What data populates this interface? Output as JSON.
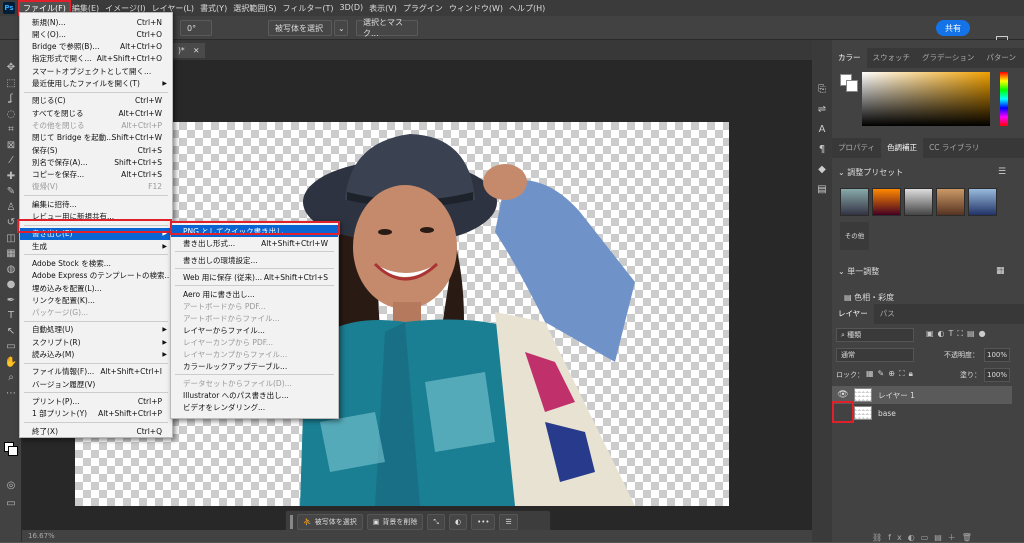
{
  "menubar": {
    "logo": "Ps",
    "items": [
      "ファイル(F)",
      "編集(E)",
      "イメージ(I)",
      "レイヤー(L)",
      "書式(Y)",
      "選択範囲(S)",
      "フィルター(T)",
      "3D(D)",
      "表示(V)",
      "プラグイン",
      "ウィンドウ(W)",
      "ヘルプ(H)"
    ]
  },
  "optbar": {
    "angle": "0°",
    "select_subject": "被写体を選択",
    "select_mask": "選択とマスク...",
    "share": "共有"
  },
  "doc_tab": {
    "title": ")*"
  },
  "file_menu": [
    {
      "label": "新規(N)...",
      "shortcut": "Ctrl+N"
    },
    {
      "label": "開く(O)...",
      "shortcut": "Ctrl+O"
    },
    {
      "label": "Bridge で参照(B)...",
      "shortcut": "Alt+Ctrl+O"
    },
    {
      "label": "指定形式で開く...",
      "shortcut": "Alt+Shift+Ctrl+O"
    },
    {
      "label": "スマートオブジェクトとして開く...",
      "shortcut": ""
    },
    {
      "label": "最近使用したファイルを開く(T)",
      "shortcut": "",
      "sub": true
    },
    {
      "sep": true
    },
    {
      "label": "閉じる(C)",
      "shortcut": "Ctrl+W"
    },
    {
      "label": "すべてを閉じる",
      "shortcut": "Alt+Ctrl+W"
    },
    {
      "label": "その他を閉じる",
      "shortcut": "Alt+Ctrl+P",
      "disabled": true
    },
    {
      "label": "閉じて Bridge を起動...",
      "shortcut": "Shift+Ctrl+W"
    },
    {
      "label": "保存(S)",
      "shortcut": "Ctrl+S"
    },
    {
      "label": "別名で保存(A)...",
      "shortcut": "Shift+Ctrl+S"
    },
    {
      "label": "コピーを保存...",
      "shortcut": "Alt+Ctrl+S"
    },
    {
      "label": "復帰(V)",
      "shortcut": "F12",
      "disabled": true
    },
    {
      "sep": true
    },
    {
      "label": "編集に招待...",
      "shortcut": ""
    },
    {
      "label": "レビュー用に新規共有...",
      "shortcut": ""
    },
    {
      "sep": true
    },
    {
      "label": "書き出し(E)",
      "shortcut": "",
      "sub": true,
      "highlight": true
    },
    {
      "label": "生成",
      "shortcut": "",
      "sub": true
    },
    {
      "sep": true
    },
    {
      "label": "Adobe Stock を検索...",
      "shortcut": ""
    },
    {
      "label": "Adobe Express のテンプレートの検索...",
      "shortcut": ""
    },
    {
      "label": "埋め込みを配置(L)...",
      "shortcut": ""
    },
    {
      "label": "リンクを配置(K)...",
      "shortcut": ""
    },
    {
      "label": "パッケージ(G)...",
      "shortcut": "",
      "disabled": true
    },
    {
      "sep": true
    },
    {
      "label": "自動処理(U)",
      "shortcut": "",
      "sub": true
    },
    {
      "label": "スクリプト(R)",
      "shortcut": "",
      "sub": true
    },
    {
      "label": "読み込み(M)",
      "shortcut": "",
      "sub": true
    },
    {
      "sep": true
    },
    {
      "label": "ファイル情報(F)...",
      "shortcut": "Alt+Shift+Ctrl+I"
    },
    {
      "label": "バージョン履歴(V)",
      "shortcut": ""
    },
    {
      "sep": true
    },
    {
      "label": "プリント(P)...",
      "shortcut": "Ctrl+P"
    },
    {
      "label": "1 部プリント(Y)",
      "shortcut": "Alt+Shift+Ctrl+P"
    },
    {
      "sep": true
    },
    {
      "label": "終了(X)",
      "shortcut": "Ctrl+Q"
    }
  ],
  "export_submenu": [
    {
      "label": "PNG としてクイック書き出し",
      "shortcut": "",
      "highlight": true
    },
    {
      "label": "書き出し形式...",
      "shortcut": "Alt+Shift+Ctrl+W"
    },
    {
      "sep": true
    },
    {
      "label": "書き出しの環境設定...",
      "shortcut": ""
    },
    {
      "sep": true
    },
    {
      "label": "Web 用に保存 (従来)...",
      "shortcut": "Alt+Shift+Ctrl+S"
    },
    {
      "sep": true
    },
    {
      "label": "Aero 用に書き出し...",
      "shortcut": ""
    },
    {
      "label": "アートボードから PDF...",
      "shortcut": "",
      "disabled": true
    },
    {
      "label": "アートボードからファイル...",
      "shortcut": "",
      "disabled": true
    },
    {
      "label": "レイヤーからファイル...",
      "shortcut": ""
    },
    {
      "label": "レイヤーカンプから PDF...",
      "shortcut": "",
      "disabled": true
    },
    {
      "label": "レイヤーカンプからファイル...",
      "shortcut": "",
      "disabled": true
    },
    {
      "label": "カラールックアップテーブル...",
      "shortcut": ""
    },
    {
      "sep": true
    },
    {
      "label": "データセットからファイル(D)...",
      "shortcut": "",
      "disabled": true
    },
    {
      "label": "Illustrator へのパス書き出し...",
      "shortcut": ""
    },
    {
      "label": "ビデオをレンダリング...",
      "shortcut": ""
    }
  ],
  "context_bar": {
    "select_subject": "被写体を選択",
    "remove_bg": "背景を削除",
    "more": "•••"
  },
  "status": {
    "text": "16.67%"
  },
  "panels": {
    "color_tabs": [
      "カラー",
      "スウォッチ",
      "グラデーション",
      "パターン"
    ],
    "adjust_tabs": [
      "プロパティ",
      "色調補正",
      "CC ライブラリ"
    ],
    "presets_title": "調整プリセット",
    "presets_more": "その他",
    "single_adjust": "単一調整",
    "hue_sat": "色相・彩度",
    "layer_tabs": [
      "レイヤー",
      "パス"
    ],
    "filter_kind": "種類",
    "blend_mode": "通常",
    "opacity_label": "不透明度：",
    "opacity": "100%",
    "lock_label": "ロック：",
    "fill_label": "塗り：",
    "fill": "100%",
    "layers": [
      {
        "name": "レイヤー 1",
        "visible": true,
        "selected": true
      },
      {
        "name": "base",
        "visible": false,
        "selected": false
      }
    ]
  },
  "colors": {
    "accent": "#1473e6",
    "highlight": "#0a64d2",
    "annotation": "#e0202a"
  }
}
